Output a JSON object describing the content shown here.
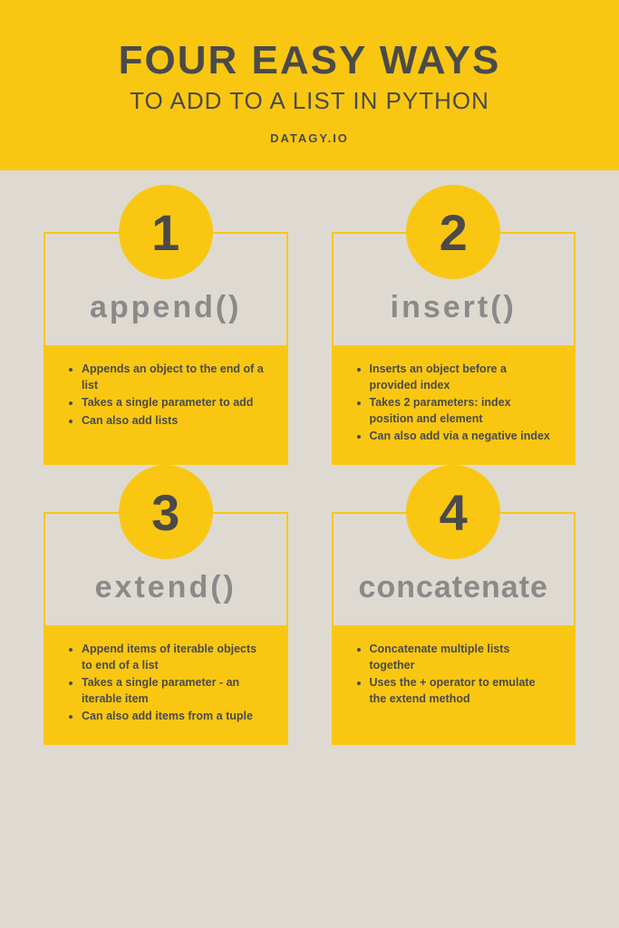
{
  "header": {
    "title": "FOUR EASY WAYS",
    "subtitle": "TO ADD TO A LIST IN PYTHON",
    "site": "DATAGY.IO"
  },
  "cards": [
    {
      "num": "1",
      "method": "append()",
      "tight": false,
      "points": [
        "Appends an object to the end of a list",
        "Takes a single parameter to add",
        "Can also add lists"
      ]
    },
    {
      "num": "2",
      "method": "insert()",
      "tight": false,
      "points": [
        "Inserts an object before a provided index",
        "Takes 2 parameters: index position and element",
        "Can also add via a negative index"
      ]
    },
    {
      "num": "3",
      "method": "extend()",
      "tight": false,
      "points": [
        "Append items of iterable objects to end of a list",
        "Takes a single parameter - an iterable item",
        "Can also add items from a tuple"
      ]
    },
    {
      "num": "4",
      "method": "concatenate",
      "tight": true,
      "points": [
        "Concatenate multiple lists together",
        "Uses the + operator to emulate the extend method"
      ]
    }
  ]
}
